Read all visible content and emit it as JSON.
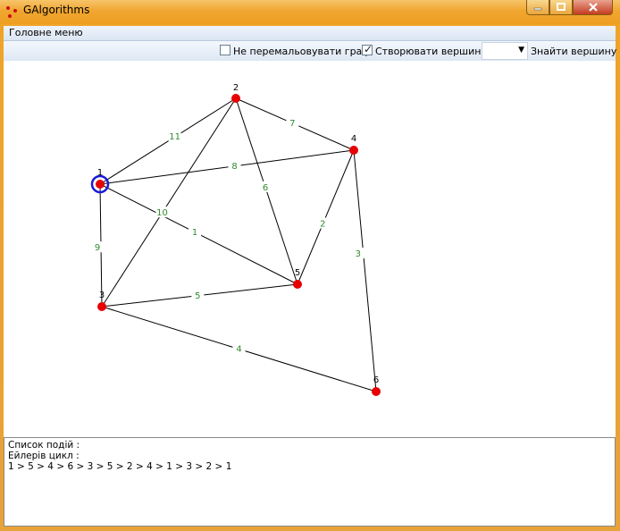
{
  "window": {
    "title": "GAlgorithms",
    "controls": [
      "minimize-icon",
      "maximize-icon",
      "close-icon"
    ]
  },
  "menu": {
    "main_label": "Головне меню"
  },
  "toolbar": {
    "no_redraw_label": "Не перемальовувати граф",
    "no_redraw_checked": false,
    "create_vertices_label": "Створювати вершини",
    "create_vertices_checked": true,
    "vertex_select_value": "",
    "find_vertex_label": "Знайти вершину"
  },
  "graph": {
    "colors": {
      "vertex": "#e60000",
      "edge": "#000000",
      "weight": "#2e8b2e",
      "selected": "#1a1ad6"
    },
    "selected_vertex": "1",
    "vertices": [
      {
        "id": "1",
        "label": "1"
      },
      {
        "id": "2",
        "label": "2"
      },
      {
        "id": "3",
        "label": "3"
      },
      {
        "id": "4",
        "label": "4"
      },
      {
        "id": "5",
        "label": "5"
      },
      {
        "id": "6",
        "label": "6"
      }
    ],
    "edges": [
      {
        "from": "1",
        "to": "2",
        "weight": "11"
      },
      {
        "from": "1",
        "to": "4",
        "weight": "8"
      },
      {
        "from": "1",
        "to": "5",
        "weight": "1"
      },
      {
        "from": "1",
        "to": "3",
        "weight": "9"
      },
      {
        "from": "2",
        "to": "4",
        "weight": "7"
      },
      {
        "from": "2",
        "to": "3",
        "weight": "10"
      },
      {
        "from": "2",
        "to": "5",
        "weight": "6"
      },
      {
        "from": "4",
        "to": "5",
        "weight": "2"
      },
      {
        "from": "4",
        "to": "6",
        "weight": "3"
      },
      {
        "from": "3",
        "to": "5",
        "weight": "5"
      },
      {
        "from": "3",
        "to": "6",
        "weight": "4"
      }
    ]
  },
  "log": {
    "events_label": "Список подій :",
    "euler_label": "Ейлерів цикл :",
    "euler_path": "1 > 5 > 4 > 6 > 3 > 5 > 2 > 4 > 1 > 3 > 2 > 1"
  }
}
